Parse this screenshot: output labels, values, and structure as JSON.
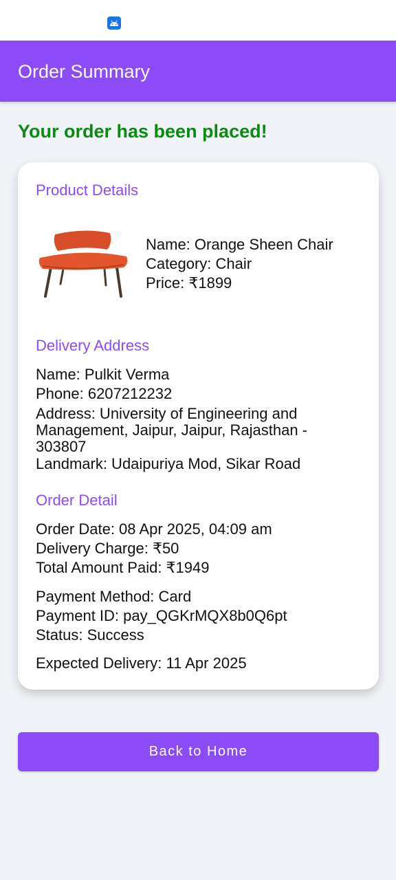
{
  "header": {
    "title": "Order Summary"
  },
  "confirmation": {
    "message": "Your order has been placed!"
  },
  "product": {
    "section_title": "Product Details",
    "name": "Name: Orange Sheen Chair",
    "category": "Category: Chair",
    "price": "Price: ₹1899",
    "image_icon": "chair-image"
  },
  "delivery": {
    "section_title": "Delivery Address",
    "name": "Name: Pulkit Verma",
    "phone": "Phone: 6207212232",
    "address": "Address: University of Engineering and Management, Jaipur, Jaipur, Rajasthan - 303807",
    "landmark": "Landmark: Udaipuriya Mod, Sikar Road"
  },
  "order": {
    "section_title": "Order Detail",
    "date": "Order Date: 08 Apr 2025, 04:09 am",
    "delivery_charge": "Delivery Charge: ₹50",
    "total": "Total Amount Paid: ₹1949",
    "payment_method": "Payment Method: Card",
    "payment_id": "Payment ID: pay_QGKrMQX8b0Q6pt",
    "status": "Status: Success",
    "expected_delivery": "Expected Delivery: 11 Apr 2025"
  },
  "actions": {
    "back_home_label": "Back to Home"
  },
  "colors": {
    "accent": "#8c4bf7",
    "success": "#0b8a12"
  }
}
